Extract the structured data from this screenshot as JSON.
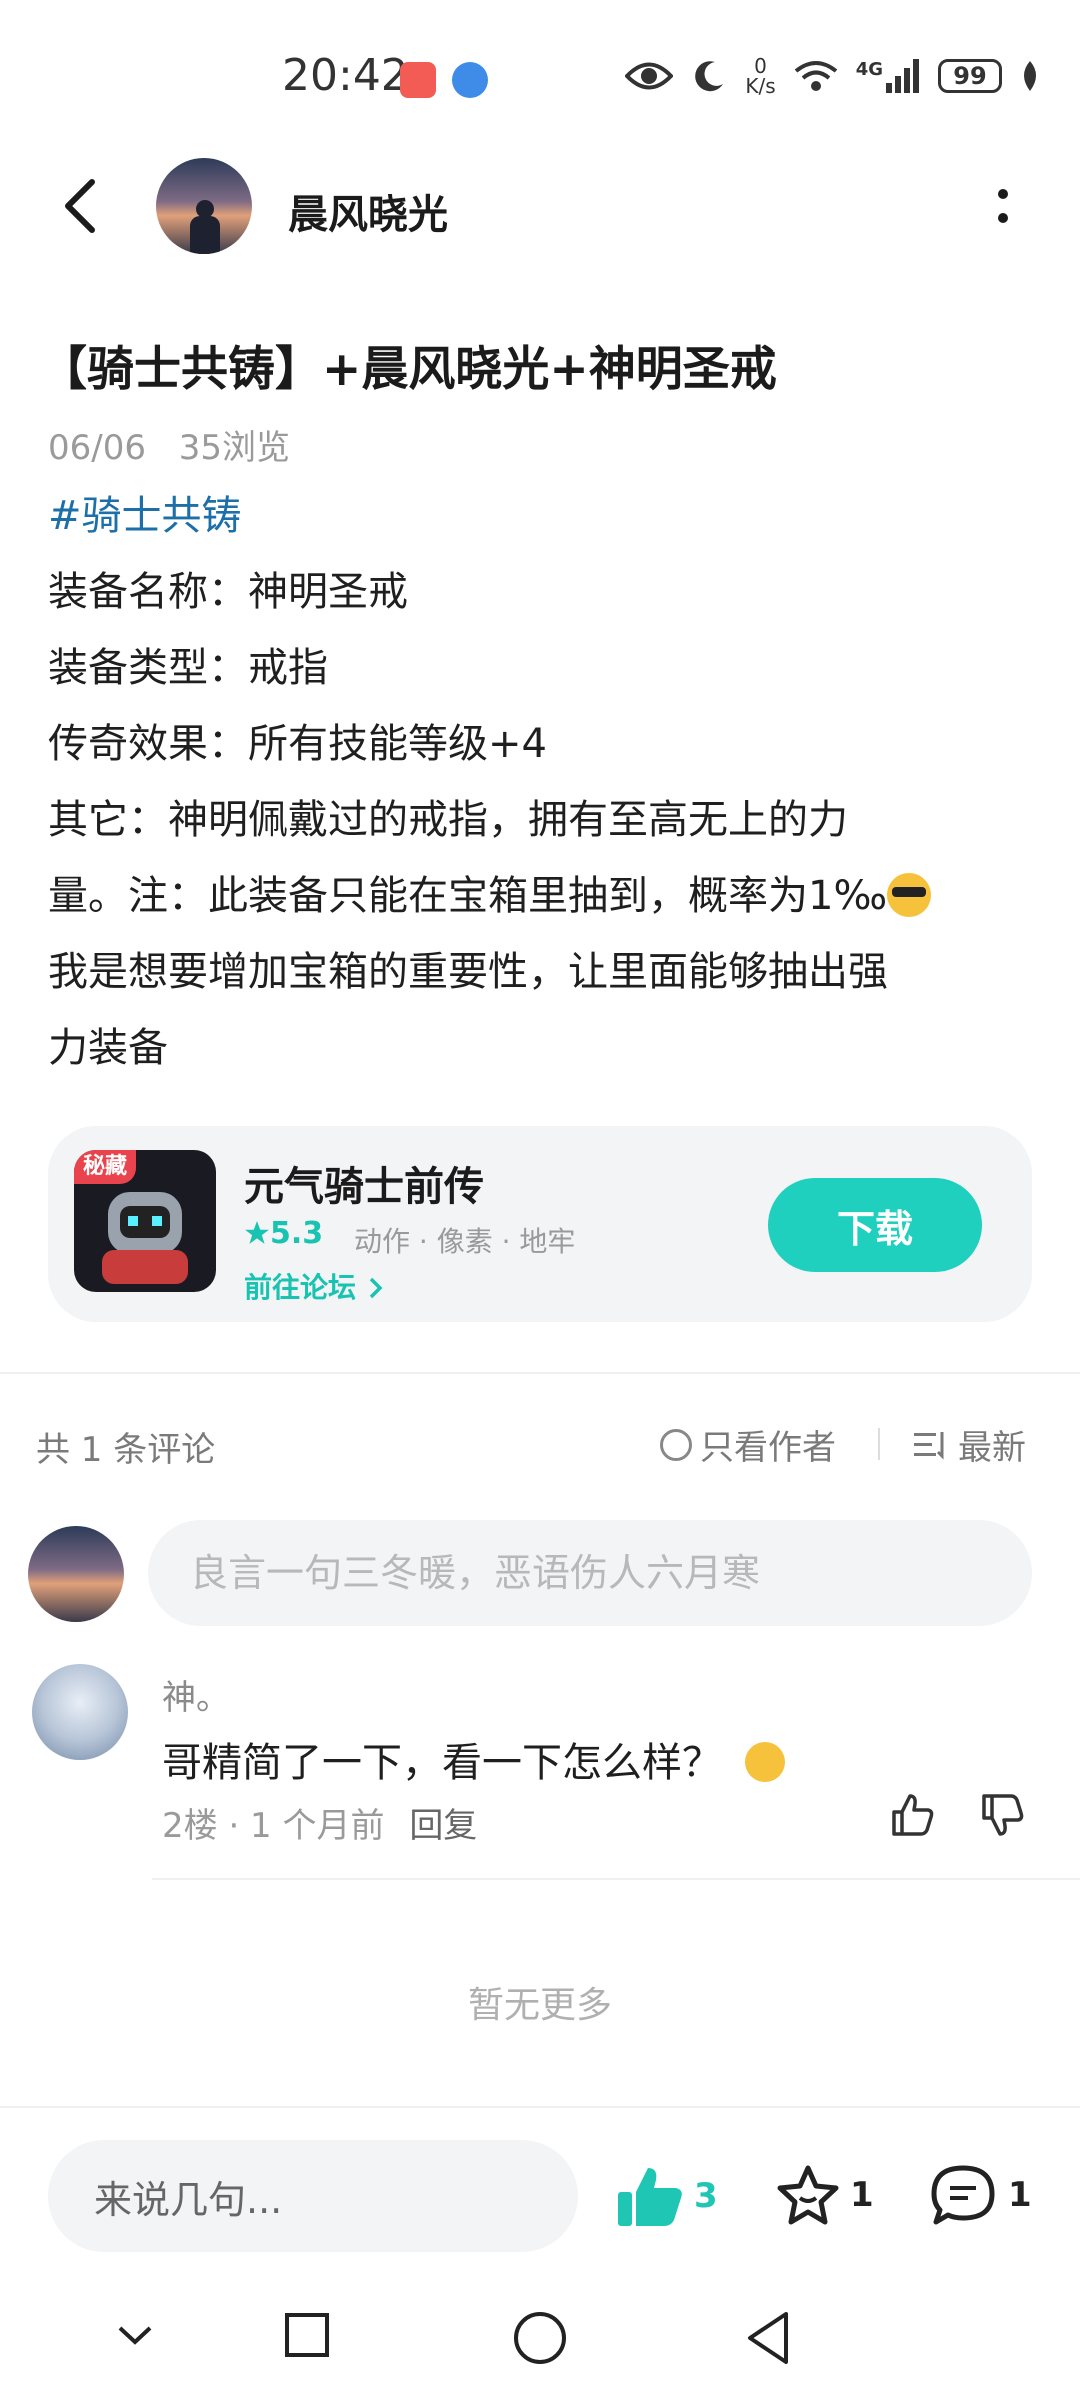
{
  "status_bar": {
    "time": "20:42",
    "net_speed_value": "0",
    "net_speed_unit": "K/s",
    "network": "4G",
    "battery": "99"
  },
  "header": {
    "author_name": "晨风晓光"
  },
  "post": {
    "title": "【骑士共铸】+晨风晓光+神明圣戒",
    "date": "06/06",
    "views": "35浏览",
    "tag": "#骑士共铸",
    "lines": [
      "装备名称：神明圣戒",
      "装备类型：戒指",
      "传奇效果：所有技能等级+4",
      "其它：神明佩戴过的戒指，拥有至高无上的力",
      "量。注：此装备只能在宝箱里抽到，概率为1‰",
      "我是想要增加宝箱的重要性，让里面能够抽出强",
      "力装备"
    ]
  },
  "app_card": {
    "badge": "秘藏",
    "name": "元气骑士前传",
    "rating": "5.3",
    "tags": "动作 · 像素 · 地牢",
    "forum_link": "前往论坛",
    "download": "下载"
  },
  "comments": {
    "count": "共 1 条评论",
    "only_author": "只看作者",
    "sort": "最新",
    "input_placeholder": "良言一句三冬暖，恶语伤人六月寒",
    "items": [
      {
        "name": "神。",
        "text": "哥精简了一下，看一下怎么样？",
        "floor_time": "2楼 · 1 个月前",
        "reply": "回复"
      }
    ],
    "no_more": "暂无更多"
  },
  "bottom_bar": {
    "input": "来说几句...",
    "likes": "3",
    "favorites": "1",
    "comments": "1"
  },
  "colors": {
    "accent": "#1fd0be",
    "tag": "#1c6fa8"
  }
}
